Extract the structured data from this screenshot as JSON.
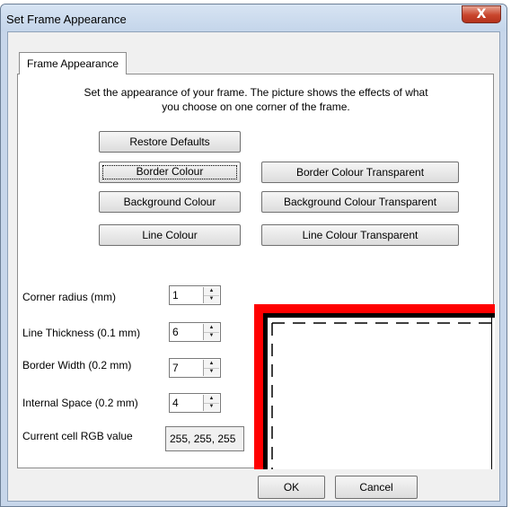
{
  "window": {
    "title": "Set Frame Appearance",
    "close_glyph": "X"
  },
  "tab": {
    "label": "Frame Appearance"
  },
  "description": {
    "line1": "Set the appearance of your frame. The picture shows the effects of what",
    "line2": "you choose on one corner of the frame."
  },
  "buttons": {
    "restore_defaults": "Restore Defaults",
    "border_colour": "Border Colour",
    "border_colour_transparent": "Border Colour Transparent",
    "background_colour": "Background Colour",
    "background_colour_transparent": "Background Colour Transparent",
    "line_colour": "Line Colour",
    "line_colour_transparent": "Line Colour Transparent",
    "ok": "OK",
    "cancel": "Cancel"
  },
  "fields": {
    "corner_radius": {
      "label": "Corner radius (mm)",
      "value": "1"
    },
    "line_thickness": {
      "label": "Line Thickness (0.1 mm)",
      "value": "6"
    },
    "border_width": {
      "label": "Border Width (0.2 mm)",
      "value": "7"
    },
    "internal_space": {
      "label": "Internal Space (0.2 mm)",
      "value": "4"
    }
  },
  "rgb": {
    "label": "Current cell RGB value",
    "value": "255, 255, 255"
  },
  "icons": {
    "close": "close-icon",
    "spin_up": "spin-up-icon",
    "spin_down": "spin-down-icon"
  },
  "colors": {
    "frame_border": "#ff0000",
    "frame_line": "#000000",
    "frame_background": "#ffffff",
    "window_chrome": "#c7d6ea",
    "close_button": "#c9452c"
  }
}
